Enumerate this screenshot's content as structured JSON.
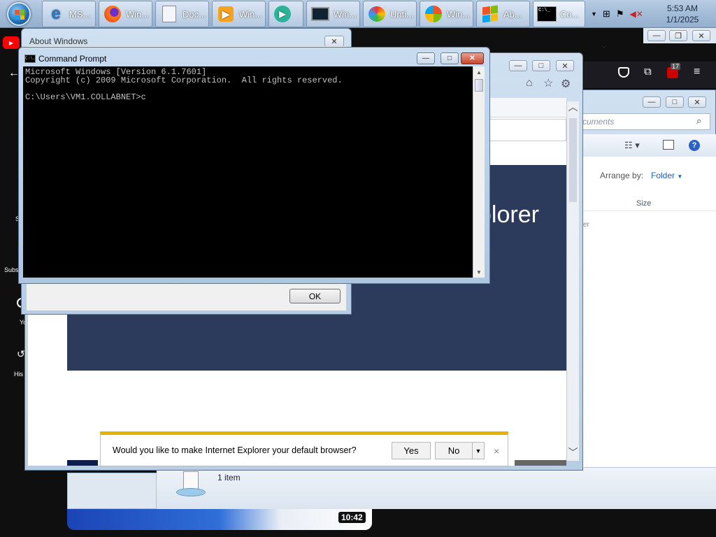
{
  "taskbar": {
    "buttons": [
      {
        "label": "MS...",
        "icon": "internet-explorer-icon"
      },
      {
        "label": "Win...",
        "icon": "firefox-icon"
      },
      {
        "label": "Doc...",
        "icon": "document-computer-icon"
      },
      {
        "label": "Win...",
        "icon": "media-player-icon"
      },
      {
        "label": "",
        "icon": "remote-app-icon"
      },
      {
        "label": "Win...",
        "icon": "terminal-monitor-icon"
      },
      {
        "label": "Unti...",
        "icon": "paint-icon"
      },
      {
        "label": "Win...",
        "icon": "windows-logo-icon"
      },
      {
        "label": "Ab...",
        "icon": "windows-flag-icon"
      },
      {
        "label": "Co...",
        "icon": "command-prompt-icon"
      }
    ],
    "time": "5:53 AM",
    "date": "1/1/2025"
  },
  "about_window": {
    "title": "About Windows",
    "ok_label": "OK"
  },
  "cmd_window": {
    "title": "Command Prompt",
    "title_icon_text": "C:\\.",
    "lines": [
      "Microsoft Windows [Version 6.1.7601]",
      "Copyright (c) 2009 Microsoft Corporation.  All rights reserved.",
      "",
      "C:\\Users\\VM1.COLLABNET>c"
    ]
  },
  "ie_window": {
    "banner_text": "olorer",
    "banner_color": "#2c3a5b"
  },
  "explorer_window": {
    "search_placeholder": "cuments",
    "arrange_label": "Arrange by:",
    "arrange_value": "Folder",
    "column_size": "Size",
    "partial_text": "er",
    "status_items": "1 item"
  },
  "browser_chrome": {
    "badge_count": "17"
  },
  "yt_sidebar": {
    "labels": [
      "S",
      "Subs",
      "Yo",
      "His"
    ]
  },
  "video": {
    "duration": "10:42"
  },
  "ie_prompt": {
    "question": "Would you like to make Internet Explorer your default browser?",
    "yes_label": "Yes",
    "no_label": "No"
  },
  "colors": {
    "accent_bar": "#e8b000",
    "console_bg": "#000000",
    "console_fg": "#c0c0c0"
  }
}
